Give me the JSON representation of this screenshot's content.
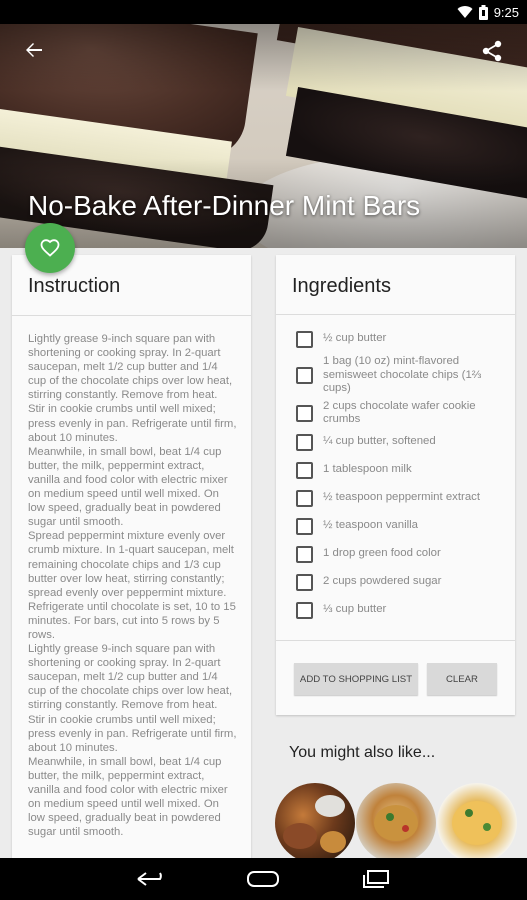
{
  "status_bar": {
    "time": "9:25",
    "icons": [
      "wifi-icon",
      "battery-icon"
    ]
  },
  "recipe": {
    "title": "No-Bake After-Dinner Mint Bars",
    "favorite_icon": "heart-icon",
    "share_icon": "share-icon",
    "back_icon": "arrow-back-icon"
  },
  "instructions": {
    "heading": "Instruction",
    "text": "Lightly grease 9-inch square pan with shortening or cooking spray. In 2-quart saucepan, melt 1/2 cup butter and 1/4 cup of the chocolate chips over low heat, stirring constantly. Remove from heat. Stir in cookie crumbs until well mixed; press evenly in pan. Refrigerate until firm, about 10 minutes.\nMeanwhile, in small bowl, beat 1/4 cup butter, the milk, peppermint extract, vanilla and food color with electric mixer on medium speed until well mixed. On low speed, gradually beat in powdered sugar until smooth.\nSpread peppermint mixture evenly over crumb mixture. In 1-quart saucepan, melt remaining chocolate chips and 1/3 cup butter over low heat, stirring constantly; spread evenly over peppermint mixture. Refrigerate until chocolate is set, 10 to 15 minutes. For bars, cut into 5 rows by 5 rows.\nLightly grease 9-inch square pan with shortening or cooking spray. In 2-quart saucepan, melt 1/2 cup butter and 1/4 cup of the chocolate chips over low heat, stirring constantly. Remove from heat. Stir in cookie crumbs until well mixed; press evenly in pan. Refrigerate until firm, about 10 minutes.\nMeanwhile, in small bowl, beat 1/4 cup butter, the milk, peppermint extract, vanilla and food color with electric mixer on medium speed until well mixed. On low speed, gradually beat in powdered sugar until smooth."
  },
  "ingredients": {
    "heading": "Ingredients",
    "items": [
      {
        "label": "½ cup butter",
        "checked": false
      },
      {
        "label": "1 bag (10 oz) mint-flavored semisweet chocolate chips (1⅔ cups)",
        "checked": false
      },
      {
        "label": "2 cups chocolate wafer cookie crumbs",
        "checked": false
      },
      {
        "label": "¼ cup butter, softened",
        "checked": false
      },
      {
        "label": "1 tablespoon milk",
        "checked": false
      },
      {
        "label": "½ teaspoon peppermint extract",
        "checked": false
      },
      {
        "label": "½ teaspoon vanilla",
        "checked": false
      },
      {
        "label": "1 drop green food color",
        "checked": false
      },
      {
        "label": "2 cups powdered sugar",
        "checked": false
      },
      {
        "label": "⅓ cup butter",
        "checked": false
      }
    ],
    "add_button": "ADD TO SHOPPING LIST",
    "clear_button": "CLEAR"
  },
  "suggestions": {
    "heading": "You might also like...",
    "items": [
      "suggestion-thumbnail-1",
      "suggestion-thumbnail-2",
      "suggestion-thumbnail-3"
    ]
  },
  "nav_bar": {
    "icons": [
      "nav-back-icon",
      "nav-home-icon",
      "nav-recents-icon"
    ]
  },
  "colors": {
    "accent_green": "#4caf50",
    "card_background": "#fafafa",
    "page_background": "#ececec"
  }
}
